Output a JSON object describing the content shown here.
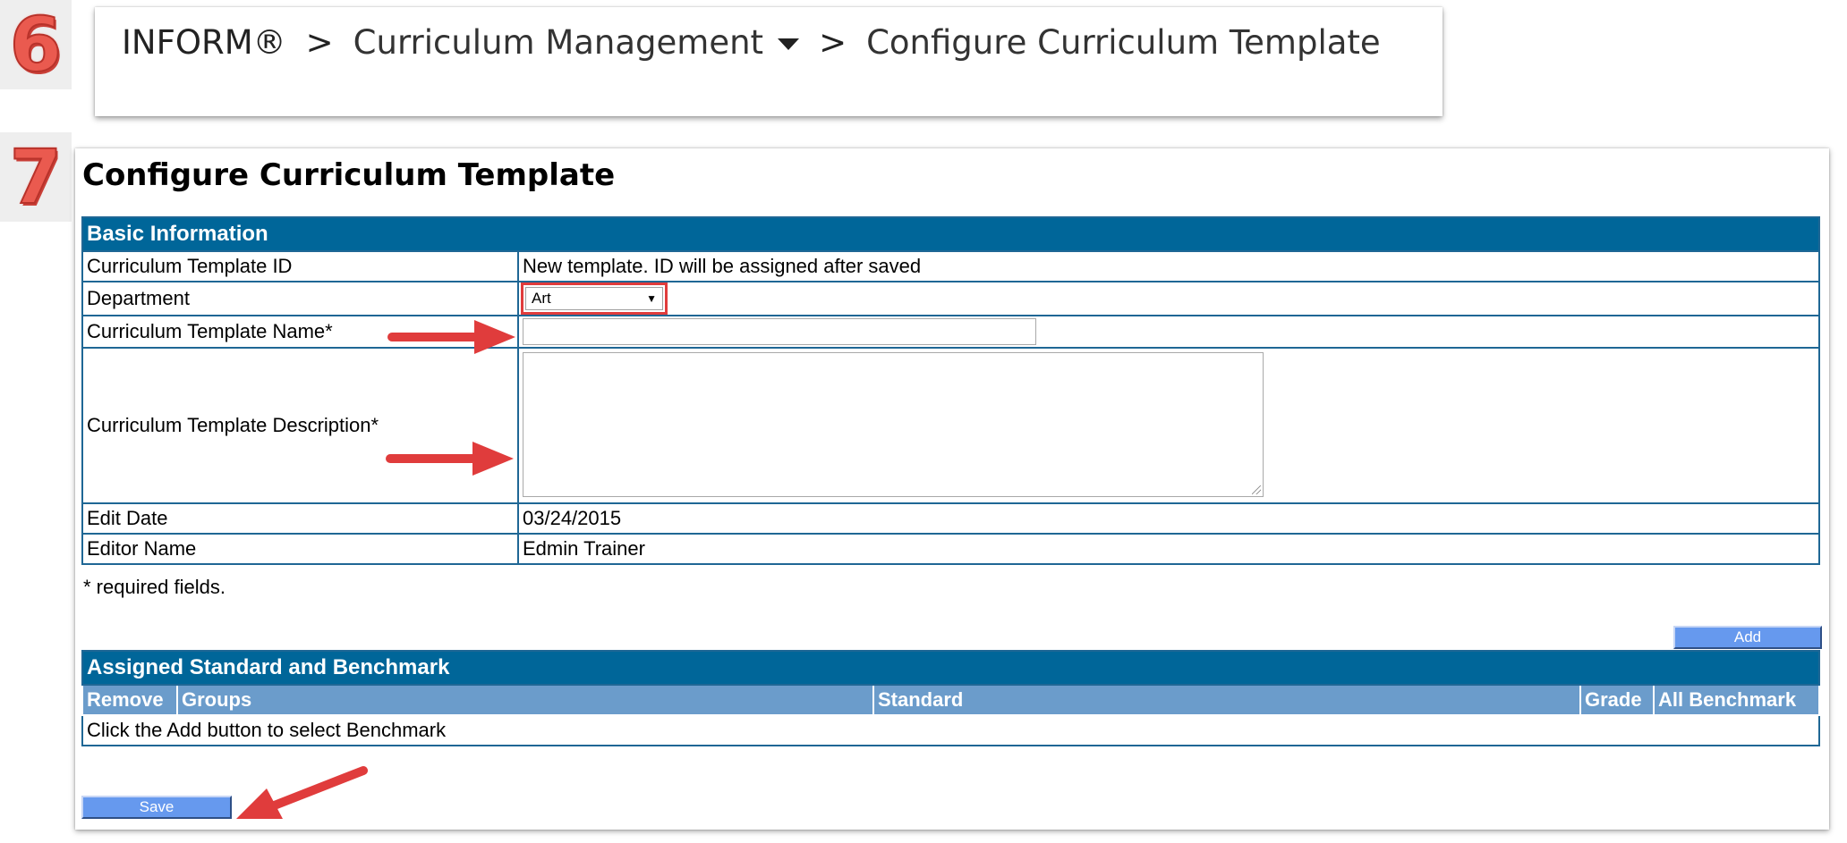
{
  "steps": {
    "first": "6",
    "second": "7"
  },
  "breadcrumb": {
    "root": "INFORM®",
    "separator": ">",
    "section": "Curriculum Management",
    "current": "Configure Curriculum Template"
  },
  "page": {
    "title": "Configure Curriculum Template"
  },
  "basic_info": {
    "header": "Basic Information",
    "rows": {
      "template_id": {
        "label": "Curriculum Template ID",
        "value": "New template. ID will be assigned after saved"
      },
      "department": {
        "label": "Department",
        "selected": "Art"
      },
      "name": {
        "label": "Curriculum Template Name*",
        "value": ""
      },
      "description": {
        "label": "Curriculum Template Description*",
        "value": ""
      },
      "edit_date": {
        "label": "Edit Date",
        "value": "03/24/2015"
      },
      "editor_name": {
        "label": "Editor Name",
        "value": "Edmin Trainer"
      }
    },
    "required_note": "* required fields."
  },
  "assigned": {
    "add_label": "Add",
    "header": "Assigned Standard and Benchmark",
    "columns": [
      "Remove",
      "Groups",
      "Standard",
      "Grade",
      "All Benchmark"
    ],
    "empty_message": "Click the Add button to select Benchmark"
  },
  "save_label": "Save",
  "colors": {
    "section_header": "#006699",
    "column_header": "#6b9ccb",
    "button": "#6699ee",
    "annotation": "#e03c3c"
  }
}
